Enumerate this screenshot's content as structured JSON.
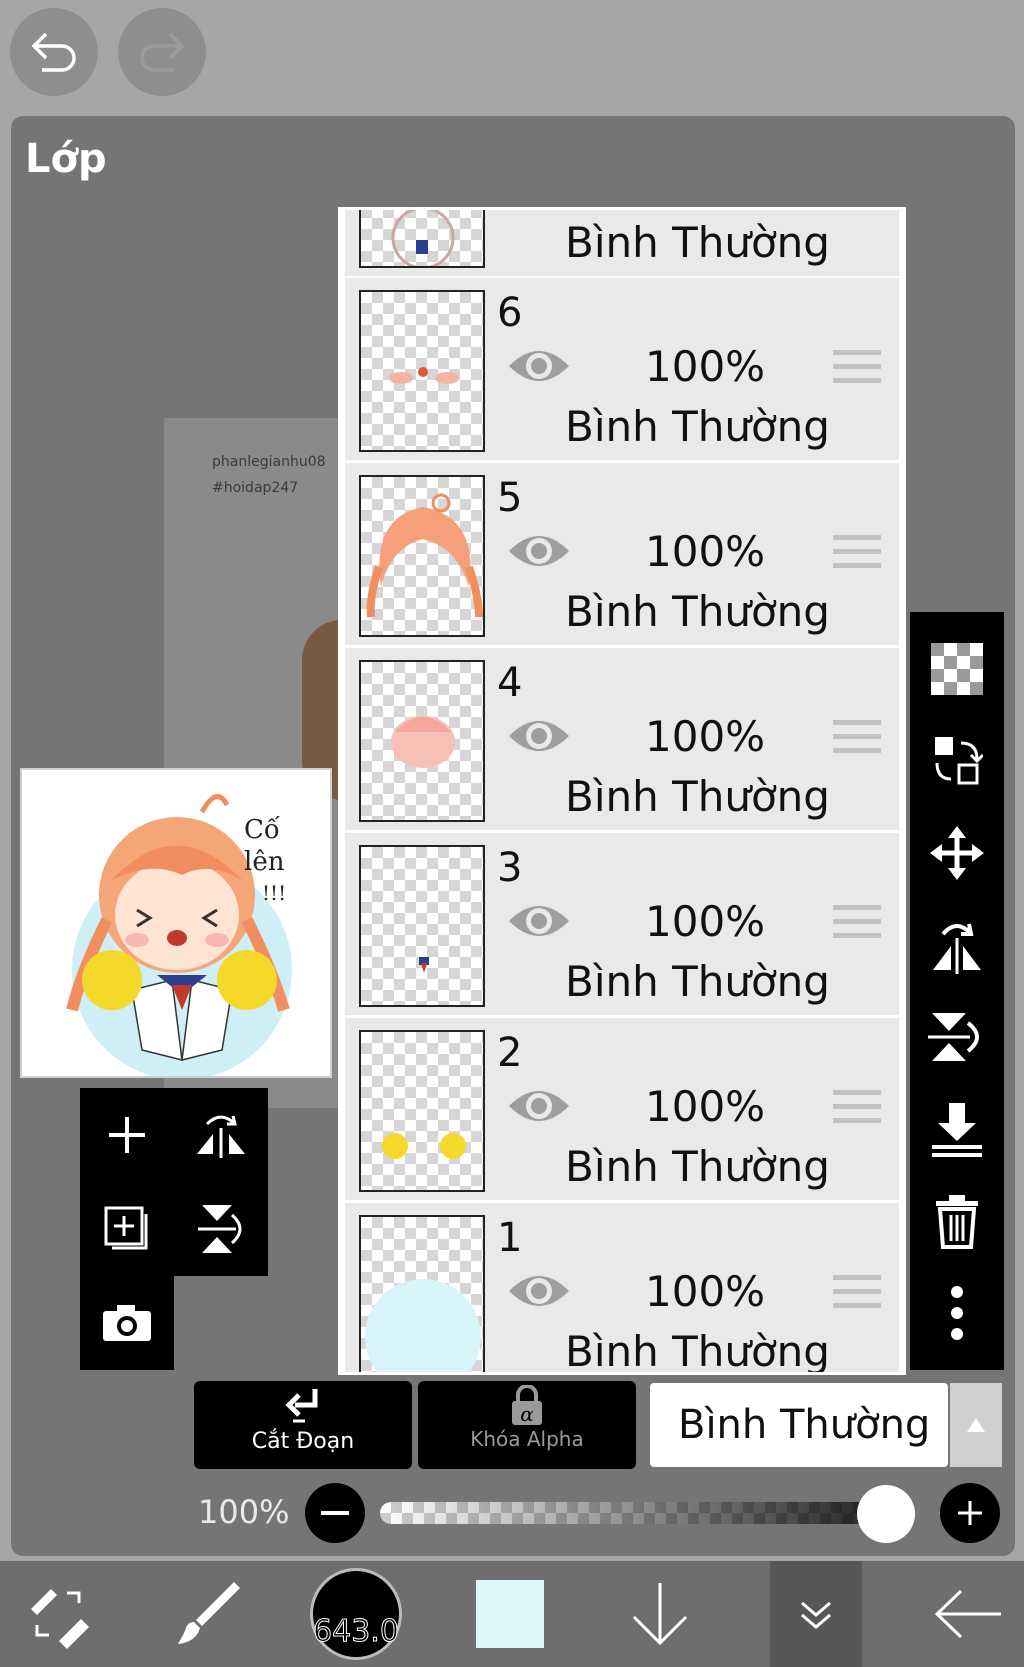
{
  "top_buttons": {
    "undo_icon": "undo-arrow-icon",
    "redo_icon": "redo-arrow-icon"
  },
  "panel": {
    "title": "Lớp"
  },
  "canvas": {
    "watermark_line1": "phanlegianhu08",
    "watermark_line2": "#hoidap247"
  },
  "preview": {
    "text_line1": "Cố",
    "text_line2": "lên",
    "text_line3": "!!!"
  },
  "layers": [
    {
      "number": "",
      "opacity": "",
      "blend": "Bình Thường"
    },
    {
      "number": "6",
      "opacity": "100%",
      "blend": "Bình Thường"
    },
    {
      "number": "5",
      "opacity": "100%",
      "blend": "Bình Thường"
    },
    {
      "number": "4",
      "opacity": "100%",
      "blend": "Bình Thường"
    },
    {
      "number": "3",
      "opacity": "100%",
      "blend": "Bình Thường"
    },
    {
      "number": "2",
      "opacity": "100%",
      "blend": "Bình Thường"
    },
    {
      "number": "1",
      "opacity": "100%",
      "blend": "Bình Thường"
    }
  ],
  "actions": {
    "clip_label": "Cắt Đoạn",
    "alpha_lock_label": "Khóa Alpha",
    "blend_mode": "Bình Thường"
  },
  "opacity": {
    "label": "100%",
    "value_fraction": 0.98
  },
  "bottom": {
    "brush_size": "643.0",
    "color": "#dff6fb"
  },
  "colors": {
    "panel": "#757575",
    "background": "#a6a6a6",
    "toolbar": "#000000"
  }
}
